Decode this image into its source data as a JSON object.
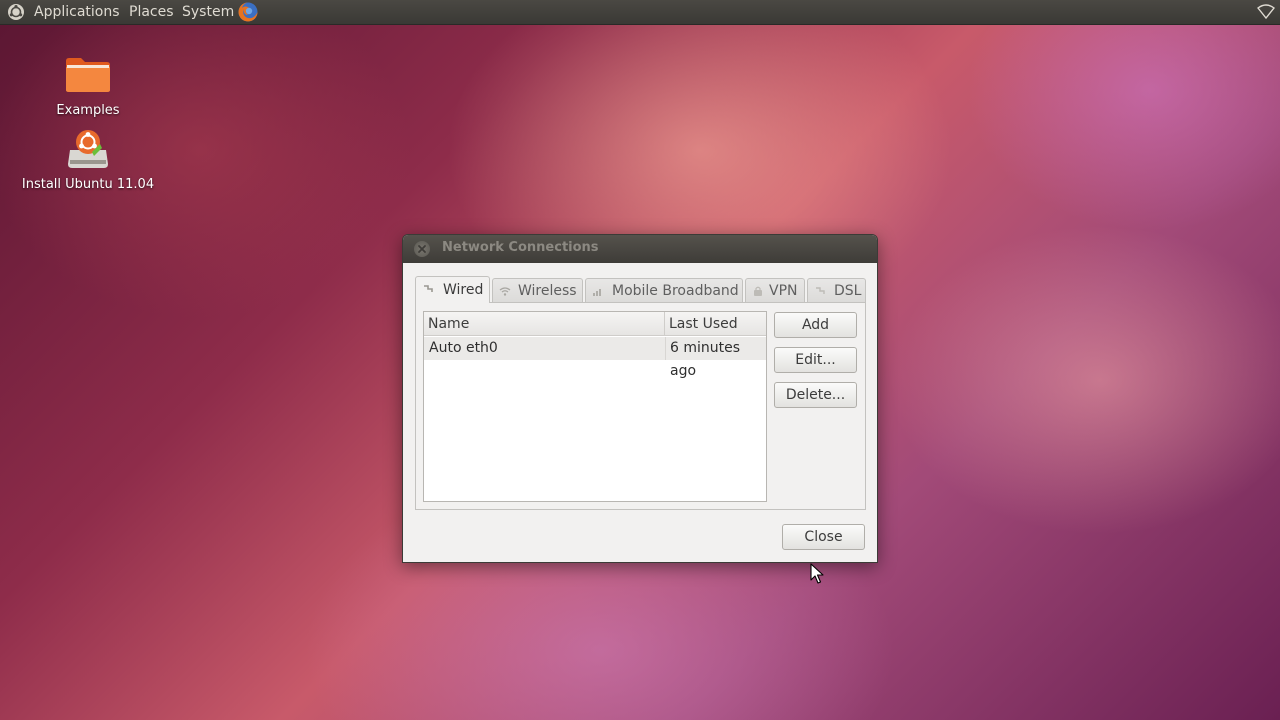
{
  "top_panel": {
    "menus": [
      "Applications",
      "Places",
      "System"
    ],
    "launcher_icon": "firefox-icon",
    "logo_icon": "ubuntu-logo-icon",
    "status_icon": "network-status-icon"
  },
  "desktop_icons": [
    {
      "label": "Examples",
      "icon": "folder-icon"
    },
    {
      "label": "Install Ubuntu 11.04",
      "icon": "installer-icon"
    }
  ],
  "dialog": {
    "title": "Network Connections",
    "tabs": [
      {
        "label": "Wired",
        "icon": "wired-icon",
        "active": true
      },
      {
        "label": "Wireless",
        "icon": "wireless-icon",
        "active": false
      },
      {
        "label": "Mobile Broadband",
        "icon": "signal-icon",
        "active": false
      },
      {
        "label": "VPN",
        "icon": "lock-icon",
        "active": false
      },
      {
        "label": "DSL",
        "icon": "dsl-icon",
        "active": false
      }
    ],
    "columns": [
      "Name",
      "Last Used"
    ],
    "rows": [
      {
        "name": "Auto eth0",
        "last_used": "6 minutes ago"
      }
    ],
    "buttons": {
      "add": "Add",
      "edit": "Edit...",
      "delete": "Delete...",
      "close": "Close"
    }
  },
  "colors": {
    "panel": "#3c3b37",
    "dialog_bg": "#f2f1f0",
    "titlebar": "#45433e"
  }
}
